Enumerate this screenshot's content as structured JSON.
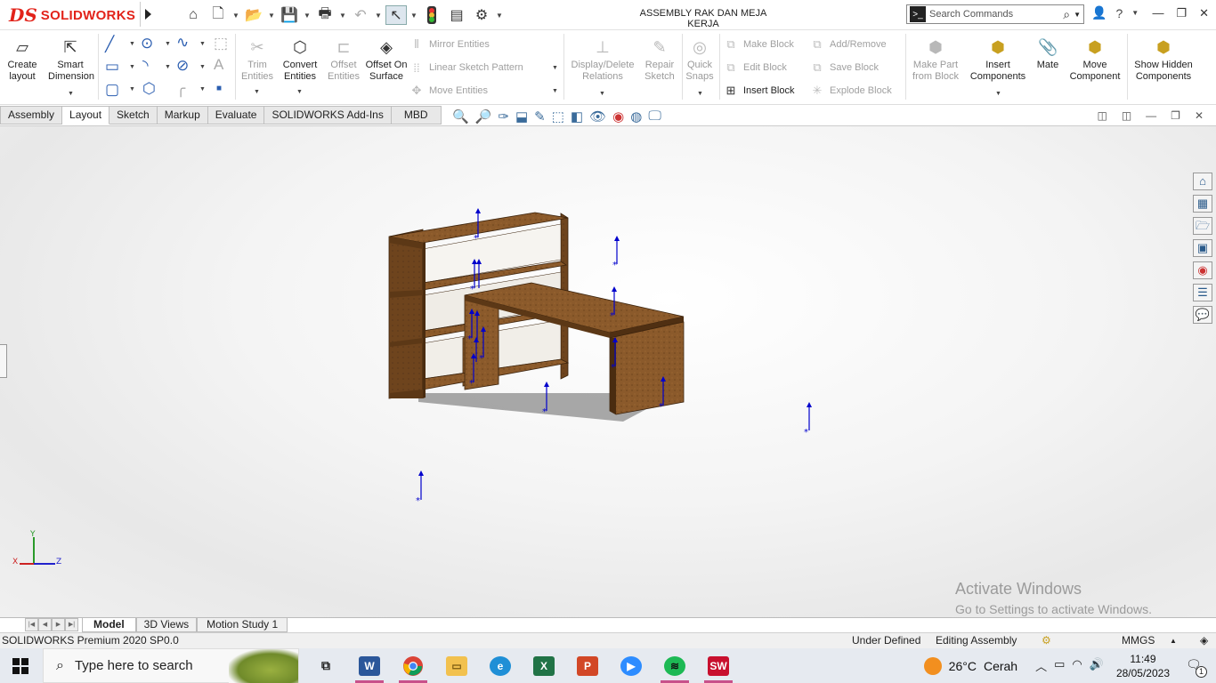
{
  "app": {
    "logo_ds": "DS",
    "logo_brand": "SOLIDWORKS",
    "document_title": "ASSEMBLY RAK DAN MEJA KERJA"
  },
  "search": {
    "placeholder": "Search Commands"
  },
  "ribbon": {
    "create_layout": "Create layout",
    "smart_dimension": "Smart Dimension",
    "trim_entities": "Trim Entities",
    "convert_entities": "Convert Entities",
    "offset_entities": "Offset Entities",
    "offset_on_surface": "Offset On Surface",
    "mirror_entities": "Mirror Entities",
    "linear_sketch_pattern": "Linear Sketch Pattern",
    "move_entities": "Move Entities",
    "display_delete_relations": "Display/Delete Relations",
    "repair_sketch": "Repair Sketch",
    "quick_snaps": "Quick Snaps",
    "make_block": "Make Block",
    "edit_block": "Edit Block",
    "insert_block": "Insert Block",
    "add_remove": "Add/Remove",
    "save_block": "Save Block",
    "explode_block": "Explode Block",
    "make_part_from_block": "Make Part from Block",
    "insert_components": "Insert Components",
    "mate": "Mate",
    "move_component": "Move Component",
    "show_hidden_components": "Show Hidden Components"
  },
  "tabs": [
    {
      "label": "Assembly"
    },
    {
      "label": "Layout",
      "active": true
    },
    {
      "label": "Sketch"
    },
    {
      "label": "Markup"
    },
    {
      "label": "Evaluate"
    },
    {
      "label": "SOLIDWORKS Add-Ins"
    },
    {
      "label": "MBD"
    }
  ],
  "viewport": {
    "watermark_line1": "Activate Windows",
    "watermark_line2": "Go to Settings to activate Windows.",
    "triad": {
      "x": "X",
      "y": "Y",
      "z": "Z"
    }
  },
  "bottom_tabs": [
    {
      "label": "Model",
      "active": true
    },
    {
      "label": "3D Views"
    },
    {
      "label": "Motion Study 1"
    }
  ],
  "status": {
    "product": "SOLIDWORKS Premium 2020 SP0.0",
    "definition": "Under Defined",
    "mode": "Editing Assembly",
    "units": "MMGS"
  },
  "taskbar": {
    "search_placeholder": "Type here to search",
    "weather_temp": "26°C",
    "weather_desc": "Cerah",
    "time": "11:49",
    "date": "28/05/2023",
    "notifications": "1"
  },
  "colors": {
    "brand_red": "#e2231a",
    "wood_top": "#8b5a2b",
    "wood_side": "#6e441d",
    "ref_arrow": "#0000cc"
  }
}
